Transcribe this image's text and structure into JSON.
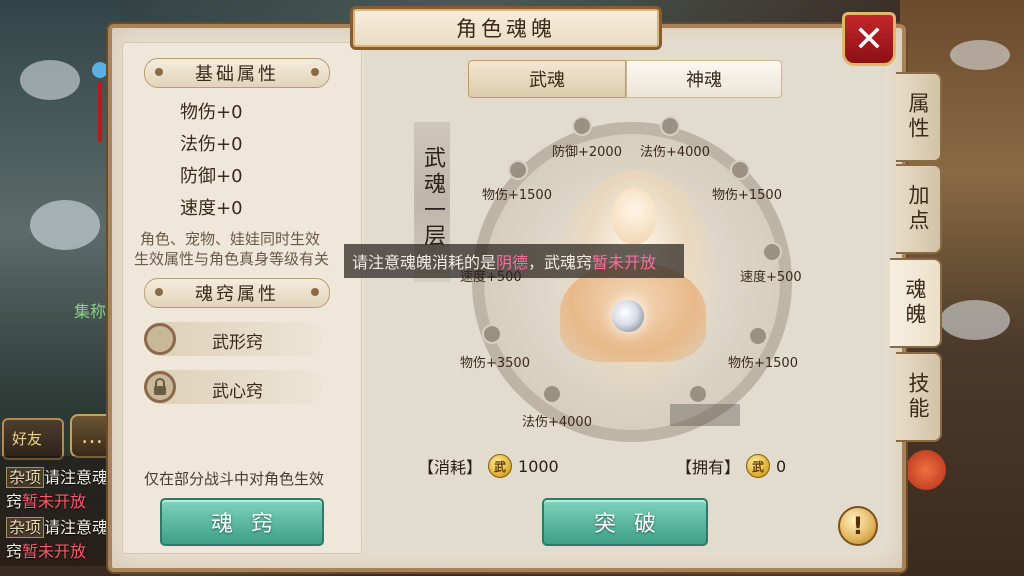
{
  "window": {
    "title": "角色魂魄",
    "close_icon": "close-icon"
  },
  "left": {
    "base_header": "基础属性",
    "stats": [
      "物伤+0",
      "法伤+0",
      "防御+0",
      "速度+0"
    ],
    "note_line1": "角色、宠物、娃娃同时生效",
    "note_line2": "生效属性与角色真身等级有关",
    "slot_header": "魂窍属性",
    "slots": [
      {
        "label": "武形窍",
        "locked": false
      },
      {
        "label": "武心窍",
        "locked": true
      }
    ],
    "footer_note": "仅在部分战斗中对角色生效",
    "button_label": "魂窍"
  },
  "tabs": {
    "active": "武魂",
    "inactive": "神魂"
  },
  "side_tabs": [
    "属性",
    "加点",
    "魂魄",
    "技能"
  ],
  "side_tab_active": "魂魄",
  "level_text": "武魂一层",
  "wheel_labels": {
    "top_left": "防御+2000",
    "top_right": "法伤+4000",
    "upper_left": "物伤+1500",
    "upper_right": "物伤+1500",
    "mid_left": "速度+500",
    "mid_right": "速度+500",
    "lower_left": "物伤+3500",
    "lower_right": "物伤+1500",
    "bottom": "法伤+4000"
  },
  "toast": {
    "prefix": "请注意魂魄消耗的是",
    "highlight1": "阴德",
    "middle": "，武魂窍",
    "highlight2": "暂未开放"
  },
  "cost": {
    "consume_label": "【消耗】",
    "consume_value": "1000",
    "own_label": "【拥有】",
    "own_value": "0",
    "coin_glyph": "武"
  },
  "breakthrough_label": "突破",
  "help_glyph": "!",
  "chat": {
    "friend_label": "好友",
    "partial_label": "集称",
    "lines": [
      {
        "tag": "杂项",
        "text": "请注意魂"
      },
      {
        "text": "窍",
        "red": "暂未开放"
      },
      {
        "tag": "杂项",
        "text": "请注意魂"
      },
      {
        "text": "窍",
        "red": "暂未开放"
      }
    ]
  },
  "colors": {
    "accent_green": "#4fb39a",
    "title_red": "#b3202a",
    "highlight_pink": "#ff6aa0"
  }
}
